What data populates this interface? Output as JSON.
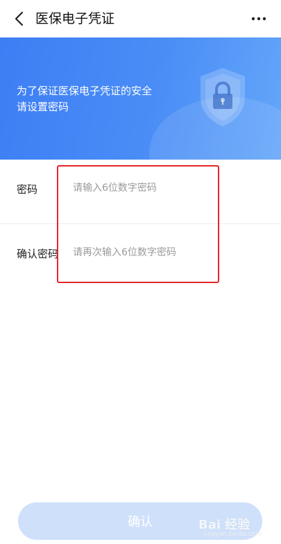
{
  "header": {
    "title": "医保电子凭证"
  },
  "banner": {
    "line1": "为了保证医保电子凭证的安全",
    "line2": "请设置密码"
  },
  "form": {
    "password_label": "密码",
    "password_placeholder": "请输入6位数字密码",
    "confirm_label": "确认密码",
    "confirm_placeholder": "请再次输入6位数字密码"
  },
  "footer": {
    "confirm_label": "确认"
  },
  "watermark": {
    "text": "Bai 经验",
    "sub": "jingyan.baidu.com"
  },
  "colors": {
    "accent": "#3d7ef4",
    "button_disabled": "#cfe0fb",
    "highlight": "#e3262a"
  },
  "icons": {
    "back": "chevron-left-icon",
    "more": "more-dots-icon",
    "shield": "shield-lock-icon"
  }
}
